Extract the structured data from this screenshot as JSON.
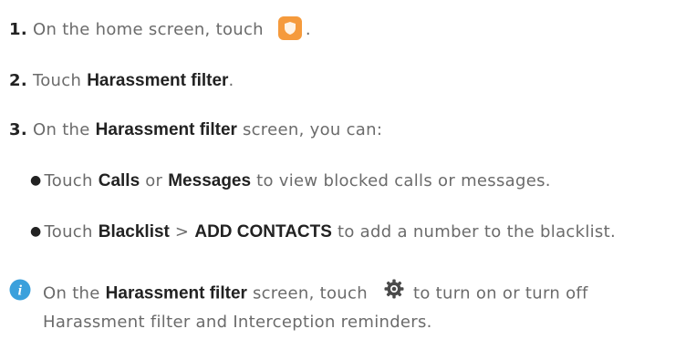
{
  "steps": [
    {
      "num": "1.",
      "text_before": "On the home screen, touch",
      "text_after": "."
    },
    {
      "num": "2.",
      "text_before": "Touch",
      "bold": "Harassment filter",
      "text_after": "."
    },
    {
      "num": "3.",
      "text_before": "On the",
      "bold": "Harassment filter",
      "text_after": "screen, you can:"
    }
  ],
  "bullets": [
    {
      "t1": "Touch",
      "b1": "Calls",
      "t2": "or",
      "b2": "Messages",
      "t3": "to view blocked calls or messages."
    },
    {
      "t1": "Touch",
      "b1": "Blacklist",
      "sep": ">",
      "b2": "ADD CONTACTS",
      "t3": "to add a number to the blacklist."
    }
  ],
  "note": {
    "t1": "On the",
    "b1": "Harassment filter",
    "t2": "screen, touch",
    "t3": "to turn on or turn off",
    "line2": "Harassment filter and Interception reminders."
  },
  "icons": {
    "app": "phone-manager-shield-icon",
    "info": "info-icon",
    "settings": "gear-icon"
  },
  "colors": {
    "text": "#6b6b6b",
    "bold_text": "#222222",
    "app_icon": "#f59a3c",
    "info_icon": "#3aa0dc"
  }
}
